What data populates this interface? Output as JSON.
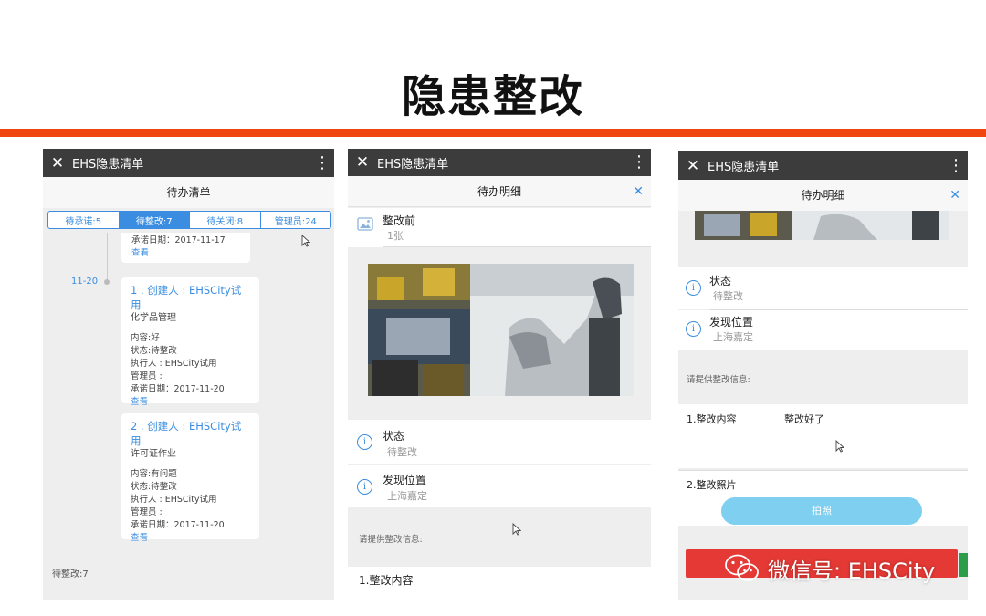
{
  "slide": {
    "title": "隐患整改",
    "watermark": "微信号: EHSCity"
  },
  "colors": {
    "accent_bar": "#f0450f",
    "app_bar": "#3c3c3c",
    "link_blue": "#3a8de0"
  },
  "phone1": {
    "app_title": "EHS隐患清单",
    "subheader": "待办清单",
    "tabs": [
      {
        "label": "待承诺:5",
        "active": false
      },
      {
        "label": "待整改:7",
        "active": true
      },
      {
        "label": "待关闭:8",
        "active": false
      },
      {
        "label": "管理员:24",
        "active": false
      }
    ],
    "partial_card": {
      "date_line": "承诺日期：2017-11-17",
      "link": "查看"
    },
    "timeline_date": "11-20",
    "cards": [
      {
        "title": "1 . 创建人 : EHSCity试用",
        "category": "化学品管理",
        "lines": [
          "内容:好",
          "状态:待整改",
          "执行人 : EHSCity试用",
          "管理员 :",
          "承诺日期：2017-11-20"
        ],
        "link": "查看"
      },
      {
        "title": "2 . 创建人 : EHSCity试用",
        "category": "许可证作业",
        "lines": [
          "内容:有问题",
          "状态:待整改",
          "执行人 : EHSCity试用",
          "管理员 :",
          "承诺日期：2017-11-20"
        ],
        "link": "查看"
      }
    ],
    "footer": "待整改:7"
  },
  "phone2": {
    "app_title": "EHS隐患清单",
    "subheader": "待办明细",
    "before": {
      "label": "整改前",
      "value": "1张"
    },
    "status": {
      "label": "状态",
      "value": "待整改"
    },
    "location": {
      "label": "发现位置",
      "value": "上海嘉定"
    },
    "hint": "请提供整改信息:",
    "content_label": "1.整改内容"
  },
  "phone3": {
    "app_title": "EHS隐患清单",
    "subheader": "待办明细",
    "status": {
      "label": "状态",
      "value": "待整改"
    },
    "location": {
      "label": "发现位置",
      "value": "上海嘉定"
    },
    "hint": "请提供整改信息:",
    "content_label": "1.整改内容",
    "content_value": "整改好了",
    "photo_label": "2.整改照片",
    "photo_button": "拍照"
  }
}
